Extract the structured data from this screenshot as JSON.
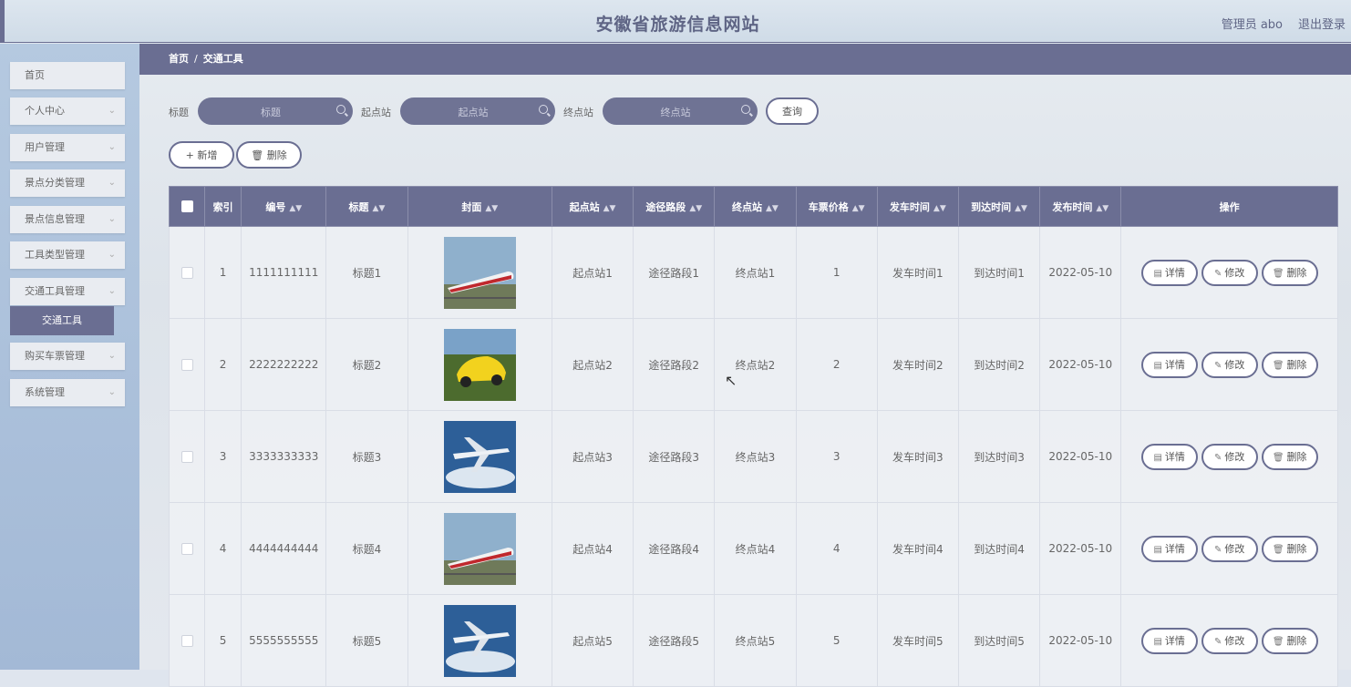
{
  "header": {
    "title": "安徽省旅游信息网站",
    "admin": "管理员 abo",
    "logout": "退出登录"
  },
  "sidebar": {
    "items": [
      {
        "label": "首页"
      },
      {
        "label": "个人中心"
      },
      {
        "label": "用户管理"
      },
      {
        "label": "景点分类管理"
      },
      {
        "label": "景点信息管理"
      },
      {
        "label": "工具类型管理"
      },
      {
        "label": "交通工具管理"
      },
      {
        "label": "购买车票管理"
      },
      {
        "label": "系统管理"
      }
    ],
    "active_sub": "交通工具"
  },
  "breadcrumb": {
    "home": "首页",
    "sep": "/",
    "current": "交通工具"
  },
  "search": {
    "title_label": "标题",
    "title_placeholder": "标题",
    "start_label": "起点站",
    "start_placeholder": "起点站",
    "end_label": "终点站",
    "end_placeholder": "终点站",
    "query": "查询"
  },
  "toolbar": {
    "add": "+ 新增",
    "delete": "删除"
  },
  "table": {
    "headers": {
      "index": "索引",
      "code": "编号",
      "title": "标题",
      "cover": "封面",
      "start": "起点站",
      "route": "途径路段",
      "end": "终点站",
      "price": "车票价格",
      "depart": "发车时间",
      "arrive": "到达时间",
      "published": "发布时间",
      "ops": "操作"
    },
    "rows": [
      {
        "index": "1",
        "code": "1111111111",
        "title": "标题1",
        "cover": "train",
        "start": "起点站1",
        "route": "途径路段1",
        "end": "终点站1",
        "price": "1",
        "depart": "发车时间1",
        "arrive": "到达时间1",
        "published": "2022-05-10"
      },
      {
        "index": "2",
        "code": "2222222222",
        "title": "标题2",
        "cover": "car",
        "start": "起点站2",
        "route": "途径路段2",
        "end": "终点站2",
        "price": "2",
        "depart": "发车时间2",
        "arrive": "到达时间2",
        "published": "2022-05-10"
      },
      {
        "index": "3",
        "code": "3333333333",
        "title": "标题3",
        "cover": "airplane",
        "start": "起点站3",
        "route": "途径路段3",
        "end": "终点站3",
        "price": "3",
        "depart": "发车时间3",
        "arrive": "到达时间3",
        "published": "2022-05-10"
      },
      {
        "index": "4",
        "code": "4444444444",
        "title": "标题4",
        "cover": "train",
        "start": "起点站4",
        "route": "途径路段4",
        "end": "终点站4",
        "price": "4",
        "depart": "发车时间4",
        "arrive": "到达时间4",
        "published": "2022-05-10"
      },
      {
        "index": "5",
        "code": "5555555555",
        "title": "标题5",
        "cover": "airplane",
        "start": "起点站5",
        "route": "途径路段5",
        "end": "终点站5",
        "price": "5",
        "depart": "发车时间5",
        "arrive": "到达时间5",
        "published": "2022-05-10"
      }
    ],
    "actions": {
      "detail": "详情",
      "edit": "修改",
      "delete": "删除"
    }
  },
  "colors": {
    "accent": "#6a6e92",
    "sidebar": "#a8bcd8"
  }
}
